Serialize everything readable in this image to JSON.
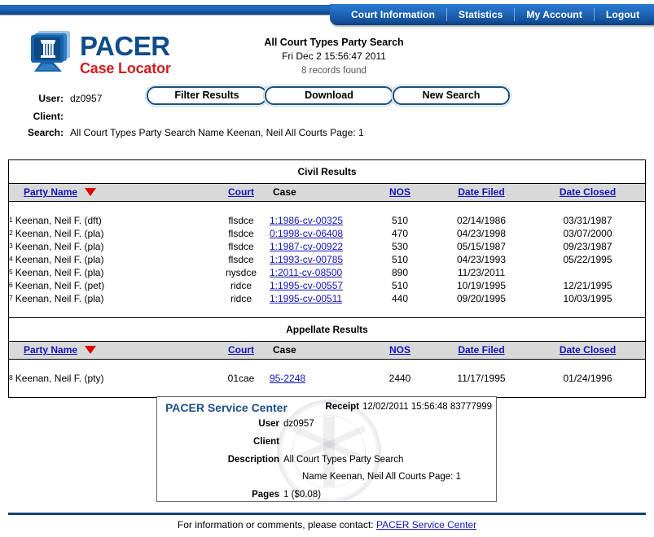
{
  "nav": {
    "items": [
      {
        "label": "Court Information",
        "name": "nav-court-information"
      },
      {
        "label": "Statistics",
        "name": "nav-statistics"
      },
      {
        "label": "My Account",
        "name": "nav-my-account"
      },
      {
        "label": "Logout",
        "name": "nav-logout"
      }
    ]
  },
  "logo": {
    "primary": "PACER",
    "secondary": "Case Locator",
    "icon": "monitor-column-icon",
    "primary_color": "#0f4c8a",
    "secondary_color": "#cc1f1f"
  },
  "header": {
    "title": "All Court Types Party Search",
    "datetime": "Fri Dec 2 15:56:47 2011",
    "records_found": "8 records found"
  },
  "search_info": {
    "user_label": "User:",
    "user_value": "dz0957",
    "client_label": "Client:",
    "client_value": "",
    "search_label": "Search:",
    "search_value": "All Court Types Party Search Name Keenan, Neil All Courts Page: 1"
  },
  "toolbar": {
    "filter_label": "Filter Results",
    "download_label": "Download",
    "new_search_label": "New Search"
  },
  "civil": {
    "section_title": "Civil Results",
    "columns": [
      "Party Name",
      "Court",
      "Case",
      "NOS",
      "Date Filed",
      "Date Closed"
    ],
    "sort_column": "Party Name",
    "sort_direction": "descending",
    "rows": [
      {
        "num": "1",
        "party": "Keenan, Neil F. (dft)",
        "court": "flsdce",
        "case": "1:1986-cv-00325",
        "nos": "510",
        "filed": "02/14/1986",
        "closed": "03/31/1987"
      },
      {
        "num": "2",
        "party": "Keenan, Neil F. (pla)",
        "court": "flsdce",
        "case": "0:1998-cv-06408",
        "nos": "470",
        "filed": "04/23/1998",
        "closed": "03/07/2000"
      },
      {
        "num": "3",
        "party": "Keenan, Neil F. (pla)",
        "court": "flsdce",
        "case": "1:1987-cv-00922",
        "nos": "530",
        "filed": "05/15/1987",
        "closed": "09/23/1987"
      },
      {
        "num": "4",
        "party": "Keenan, Neil F. (pla)",
        "court": "flsdce",
        "case": "1:1993-cv-00785",
        "nos": "510",
        "filed": "04/23/1993",
        "closed": "05/22/1995"
      },
      {
        "num": "5",
        "party": "Keenan, Neil F. (pla)",
        "court": "nysdce",
        "case": "1:2011-cv-08500",
        "nos": "890",
        "filed": "11/23/2011",
        "closed": ""
      },
      {
        "num": "6",
        "party": "Keenan, Neil F. (pet)",
        "court": "ridce",
        "case": "1:1995-cv-00557",
        "nos": "510",
        "filed": "10/19/1995",
        "closed": "12/21/1995"
      },
      {
        "num": "7",
        "party": "Keenan, Neil F. (pla)",
        "court": "ridce",
        "case": "1:1995-cv-00511",
        "nos": "440",
        "filed": "09/20/1995",
        "closed": "10/03/1995"
      }
    ]
  },
  "appellate": {
    "section_title": "Appellate Results",
    "columns": [
      "Party Name",
      "Court",
      "Case",
      "NOS",
      "Date Filed",
      "Date Closed"
    ],
    "sort_column": "Party Name",
    "sort_direction": "descending",
    "rows": [
      {
        "num": "8",
        "party": "Keenan, Neil F. (pty)",
        "court": "01cae",
        "case": "95-2248",
        "nos": "2440",
        "filed": "11/17/1995",
        "closed": "01/24/1996"
      }
    ]
  },
  "receipt": {
    "title": "PACER Service Center",
    "receipt_label": "Receipt",
    "receipt_value": "12/02/2011 15:56:48 83777999",
    "user_label": "User",
    "user_value": "dz0957",
    "client_label": "Client",
    "client_value": "",
    "description_label": "Description",
    "description_value": "All Court Types Party Search",
    "description_value2": "Name Keenan, Neil All Courts Page: 1",
    "pages_label": "Pages",
    "pages_value": "1 ($0.08)",
    "watermark": "us-courts-seal-icon"
  },
  "footer": {
    "text": "For information or comments, please contact:",
    "link": "PACER Service Center"
  },
  "colors": {
    "nav_blue": "#1f66b8",
    "link_blue": "#1414b8",
    "sort_caret_red": "#e00000",
    "table_header_gray": "#d9d9d9",
    "footer_rule": "#14406e"
  }
}
